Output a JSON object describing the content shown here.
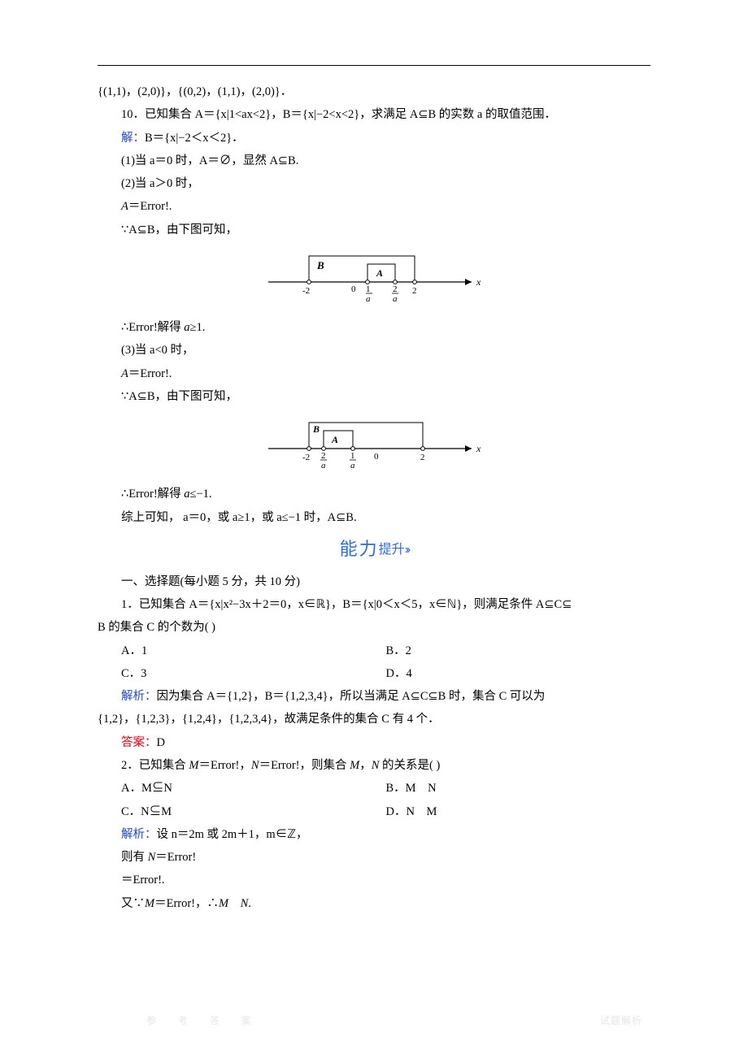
{
  "intro_line": "{(1,1)，(2,0)}，{(0,2)，(1,1)，(2,0)}．",
  "q10": {
    "text": "10．已知集合 A＝{x|1<ax<2}，B＝{x|−2<x<2}，求满足 A⊆B 的实数 a 的取值范围．",
    "sol_label": "解：",
    "sol_start": "B＝{x|−2＜x＜2}．",
    "case1": "(1)当 a＝0 时，A＝∅，显然 A⊆B.",
    "case2_head": "(2)当 a＞0 时，",
    "a_eq": "A＝Error!.",
    "since": "∵A⊆B，由下图可知，",
    "therefore_a_ge": "∴Error!解得 a≥1.",
    "case3_head": "(3)当 a<0 时，",
    "therefore_a_le": "∴Error!解得 a≤−1.",
    "summary": "综上可知，  a＝0，或 a≥1，或 a≤−1 时，A⊆B."
  },
  "ability": {
    "main": "能力",
    "sub": "提升"
  },
  "sec1": {
    "heading": "一、选择题(每小题 5 分，共 10 分)",
    "q1": {
      "text_a": "1．已知集合 A＝{x|x²−3x＋2＝0，x∈ℝ}，B＝{x|0＜x＜5，x∈ℕ}，则满足条件 A⊆C⊆",
      "text_b": "B 的集合 C 的个数为(      )",
      "opts": {
        "A": "A．1",
        "B": "B．2",
        "C": "C．3",
        "D": "D．4"
      },
      "jiexi_label": "解析：",
      "jiexi_a": "因为集合 A＝{1,2}，B＝{1,2,3,4}，所以当满足 A⊆C⊆B 时，集合 C 可以为",
      "jiexi_b": "{1,2}，{1,2,3}，{1,2,4}，{1,2,3,4}，故满足条件的集合 C 有 4 个．",
      "ans_label": "答案：",
      "ans": "D"
    },
    "q2": {
      "text": "2．已知集合 M＝Error!，N＝Error!，则集合 M，N 的关系是(      )",
      "opts": {
        "A": "A．M⊆N",
        "B": "B．M　N",
        "C": "C．N⊆M",
        "D": "D．N　M"
      },
      "jiexi_label": "解析：",
      "jiexi_a": "设 n＝2m 或 2m＋1，m∈ℤ，",
      "line_b": "则有 N＝Error!",
      "line_c": "＝Error!.",
      "line_d": "又∵M＝Error!，∴M　N."
    }
  },
  "wm_left": "参  考  答  案",
  "wm_right": "试题解析"
}
